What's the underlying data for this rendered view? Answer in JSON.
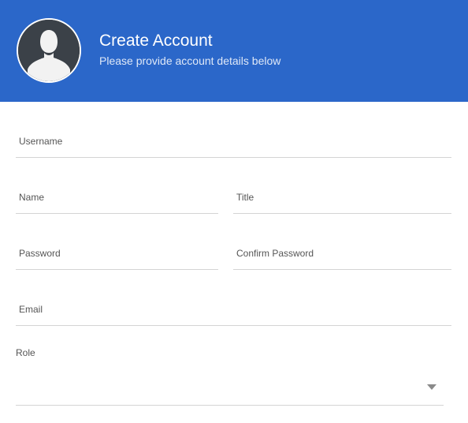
{
  "header": {
    "title": "Create Account",
    "subtitle": "Please provide account details below",
    "background_color": "#2b67c9"
  },
  "avatar": {
    "icon": "user-silhouette-icon"
  },
  "form": {
    "username": {
      "placeholder": "Username",
      "value": ""
    },
    "name": {
      "placeholder": "Name",
      "value": ""
    },
    "title": {
      "placeholder": "Title",
      "value": ""
    },
    "password": {
      "placeholder": "Password",
      "value": ""
    },
    "confirm_password": {
      "placeholder": "Confirm Password",
      "value": ""
    },
    "email": {
      "placeholder": "Email",
      "value": ""
    },
    "role": {
      "label": "Role",
      "selected": "",
      "icon": "chevron-down-icon"
    }
  }
}
